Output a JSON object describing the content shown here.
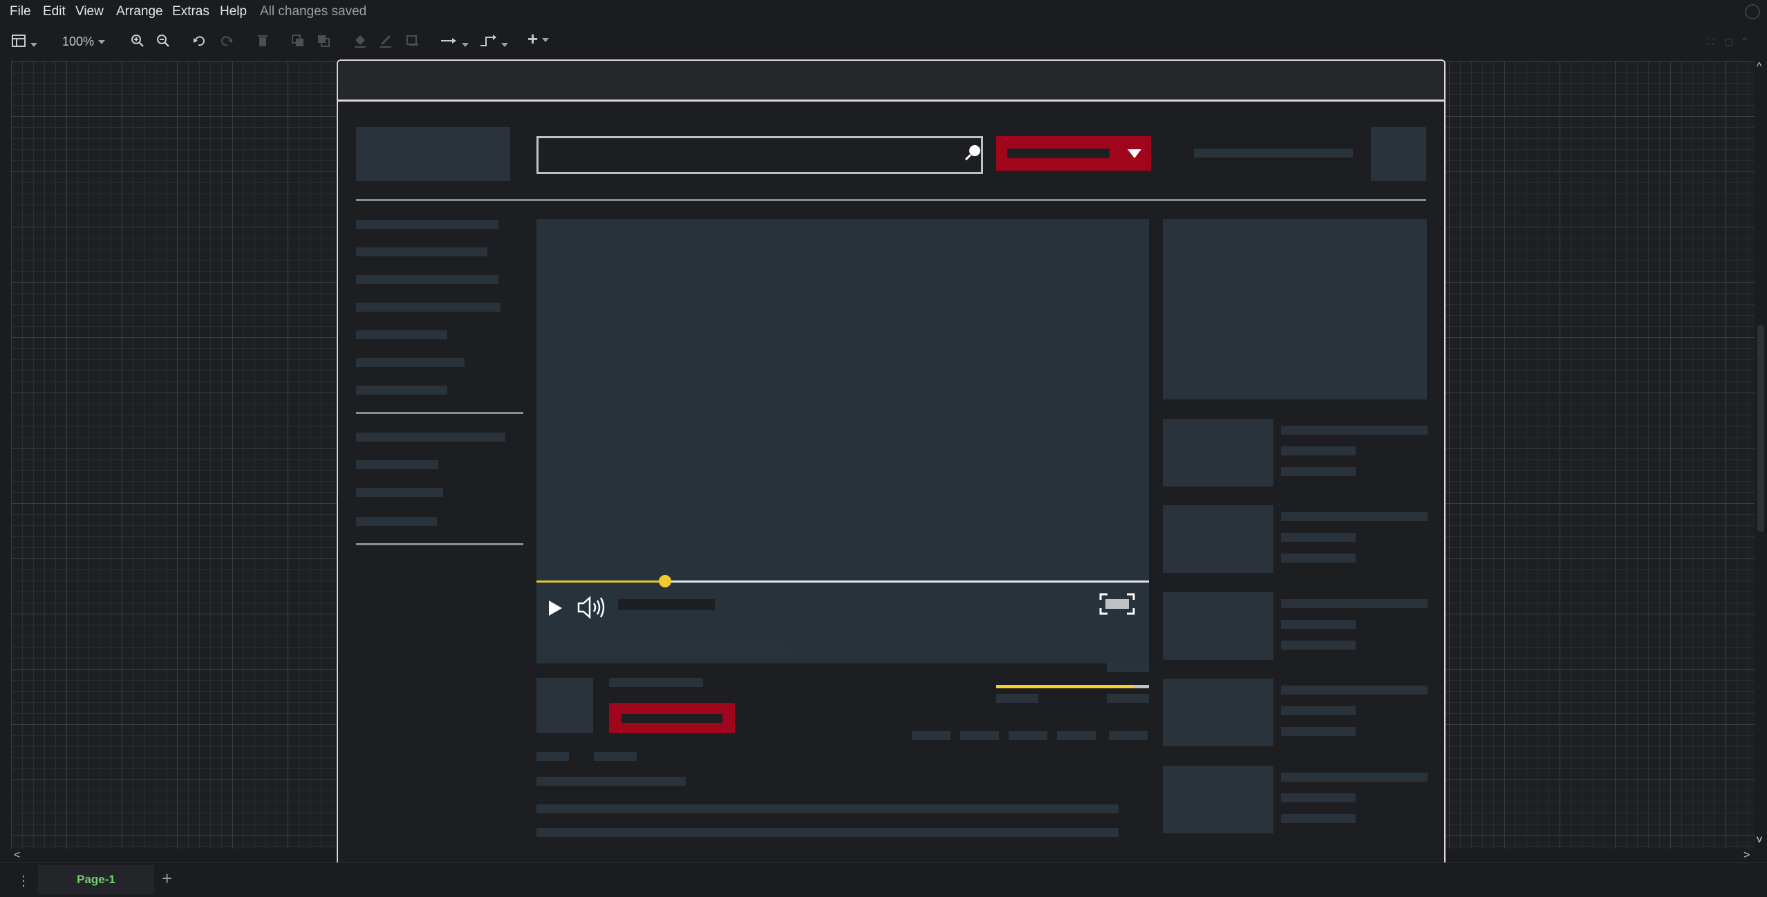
{
  "menubar": {
    "items": [
      "File",
      "Edit",
      "View",
      "Arrange",
      "Extras",
      "Help"
    ],
    "status": "All changes saved"
  },
  "toolbar": {
    "zoom": "100%",
    "icons": [
      "format-panel-icon",
      "zoom-in-icon",
      "zoom-out-icon",
      "undo-icon",
      "redo-icon",
      "delete-icon",
      "to-front-icon",
      "to-back-icon",
      "fill-color-icon",
      "line-color-icon",
      "shadow-icon",
      "connection-icon",
      "waypoints-icon",
      "insert-plus-icon"
    ]
  },
  "pages": {
    "active": "Page-1",
    "add_label": "+"
  },
  "mockup": {
    "video_progress": 0.21,
    "rating_fill": 0.9,
    "accent_red": "#a0061b",
    "accent_yellow": "#f2c82f"
  }
}
